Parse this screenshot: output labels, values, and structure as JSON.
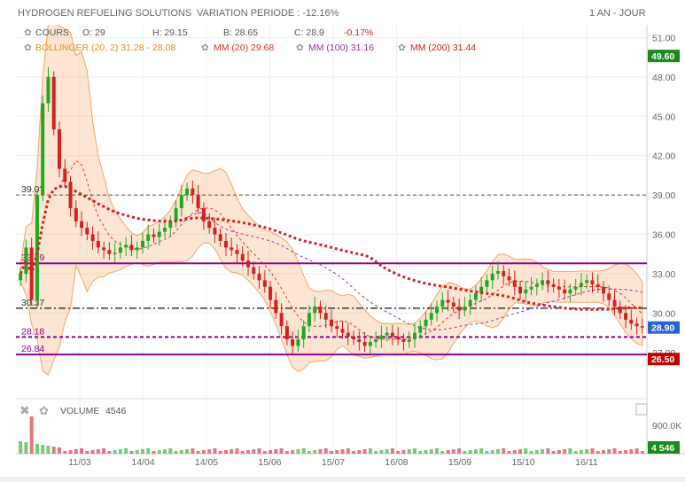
{
  "header": {
    "title": "HYDROGEN REFUELING SOLUTIONS",
    "variation": "VARIATION PERIODE : -12.16%",
    "period": "1 AN - JOUR"
  },
  "legend": {
    "cours_label": "COURS",
    "open": "O: 29",
    "high": "H: 29.15",
    "low": "B: 28.65",
    "close": "C: 28.9",
    "change": "-0.17%",
    "bollinger": "BOLLINGER (20, 2) 31.28 - 28.08",
    "mm20": "MM (20) 29.68",
    "mm100": "MM (100) 31.16",
    "mm200": "MM (200) 31.44",
    "volume_label": "VOLUME",
    "volume_value": "4546"
  },
  "colors": {
    "up": "#22a722",
    "down": "#d42020",
    "band": "#f4a460",
    "mm20": "#e03030",
    "mm100": "#9b30a0",
    "mm200": "#d42020",
    "level": "#8b008b",
    "tag_green": "#1a8a1a",
    "tag_blue": "#2a62d2",
    "tag_red": "#c00000"
  },
  "price_axis": {
    "ylim": [
      25.5,
      51.5
    ],
    "ticks": [
      "51.00",
      "48.00",
      "45.00",
      "42.00",
      "39.00",
      "36.00",
      "33.00",
      "30.00",
      "27.00"
    ],
    "tick_values": [
      51,
      48,
      45,
      42,
      39,
      36,
      33,
      30,
      27
    ]
  },
  "price_tags": [
    {
      "label": "49.60",
      "value": 49.6,
      "color": "#1a8a1a"
    },
    {
      "label": "28.90",
      "value": 28.9,
      "color": "#2a62d2"
    },
    {
      "label": "26.50",
      "value": 26.5,
      "color": "#c00000"
    }
  ],
  "levels": [
    {
      "label": "39.0?",
      "value": 39.0,
      "style": "dashed-gray"
    },
    {
      "label": "33.79",
      "value": 33.79,
      "style": "solid-purple"
    },
    {
      "label": "30.37",
      "value": 30.37,
      "style": "dashdot-black"
    },
    {
      "label": "28.18",
      "value": 28.18,
      "style": "dotted-purple"
    },
    {
      "label": "26.84",
      "value": 26.84,
      "style": "solid-purple"
    }
  ],
  "x_axis": {
    "labels": [
      "11/03",
      "14/04",
      "14/05",
      "15/06",
      "15/07",
      "16/08",
      "15/09",
      "15/10",
      "16/11"
    ]
  },
  "volume_axis": {
    "tick": "900.0K",
    "tag": "4 546"
  },
  "chart_data": {
    "type": "candlestick",
    "series_close": [
      33,
      35,
      31,
      39,
      46,
      48,
      44,
      41,
      40,
      38,
      37,
      36.5,
      36,
      35.5,
      35,
      34.8,
      34.5,
      34.6,
      35,
      35.2,
      34.8,
      35,
      35.5,
      36,
      35.8,
      36.2,
      36.5,
      37,
      38,
      39,
      39.5,
      39,
      38,
      37,
      36.5,
      36,
      35.5,
      35,
      34.8,
      34.5,
      34,
      33.5,
      33,
      32.5,
      32,
      31,
      30,
      29,
      28,
      27.5,
      28,
      29,
      30,
      30.5,
      30,
      29.5,
      29,
      28.8,
      28.5,
      28.2,
      28,
      27.8,
      27.5,
      27.8,
      28,
      28.3,
      28.5,
      28.2,
      28,
      27.8,
      28,
      28.5,
      29,
      29.5,
      30,
      30.5,
      31,
      30.8,
      30.5,
      30.2,
      30.5,
      31,
      31.5,
      32,
      32.5,
      33,
      33.2,
      32.8,
      32.5,
      32,
      31.5,
      31.8,
      32,
      32.2,
      32.5,
      32.2,
      32,
      31.8,
      31.5,
      31.8,
      32,
      32.3,
      32.5,
      32.2,
      32,
      31.5,
      31,
      30.5,
      30,
      29.5,
      29.2,
      29,
      28.9
    ],
    "indicators": [
      "Bollinger (20, 2)",
      "MM (20)",
      "MM (100)",
      "MM (200)"
    ],
    "ylim": [
      25.5,
      51.5
    ],
    "xlabel": "",
    "ylabel": ""
  }
}
